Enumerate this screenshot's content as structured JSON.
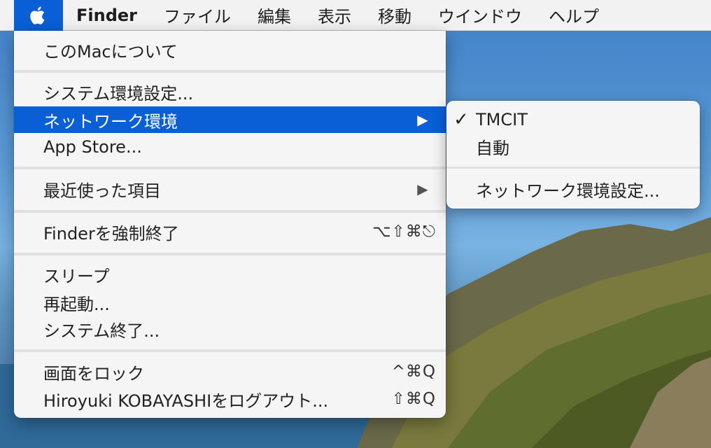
{
  "menubar": {
    "apple_icon": "apple-icon",
    "app_name": "Finder",
    "items": [
      "ファイル",
      "編集",
      "表示",
      "移動",
      "ウインドウ",
      "ヘルプ"
    ]
  },
  "apple_menu": {
    "items": [
      {
        "label": "このMacについて"
      },
      {
        "label": "システム環境設定..."
      },
      {
        "label": "ネットワーク環境",
        "submenu_arrow": "▶"
      },
      {
        "label": "App Store..."
      },
      {
        "label": "最近使った項目",
        "submenu_arrow": "▶"
      },
      {
        "label": "Finderを強制終了",
        "shortcut": "⌥⇧⌘⎋"
      },
      {
        "label": "スリープ"
      },
      {
        "label": "再起動..."
      },
      {
        "label": "システム終了..."
      },
      {
        "label": "画面をロック",
        "shortcut": "^⌘Q"
      },
      {
        "label": "Hiroyuki KOBAYASHIをログアウト...",
        "shortcut": "⇧⌘Q"
      }
    ]
  },
  "location_submenu": {
    "items": [
      {
        "check": "✓",
        "label": "TMCIT"
      },
      {
        "check": "",
        "label": "自動"
      },
      {
        "check": "",
        "label": "ネットワーク環境設定..."
      }
    ]
  },
  "colors": {
    "highlight": "#0a5fd6",
    "menu_bg": "#f5f5f5"
  }
}
